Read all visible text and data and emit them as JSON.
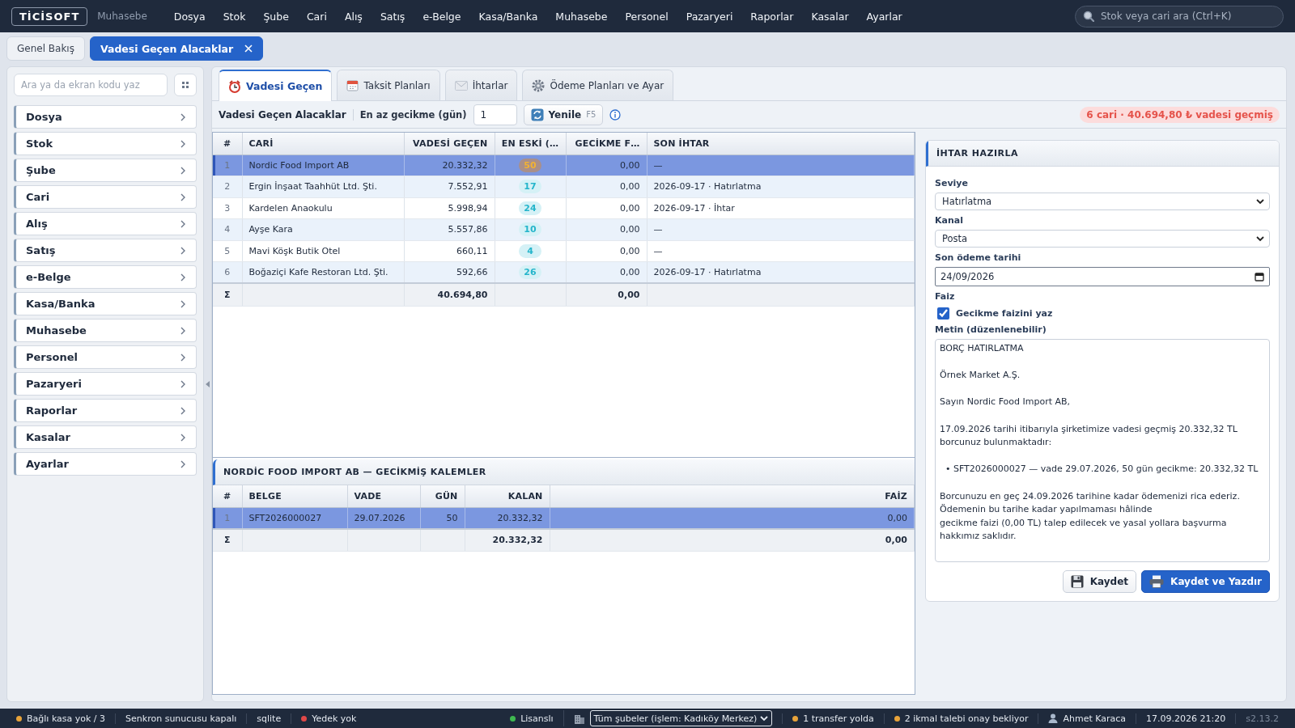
{
  "app": {
    "logo": "TİCİSOFT",
    "module": "Muhasebe"
  },
  "menu": [
    "Dosya",
    "Stok",
    "Şube",
    "Cari",
    "Alış",
    "Satış",
    "e-Belge",
    "Kasa/Banka",
    "Muhasebe",
    "Personel",
    "Pazaryeri",
    "Raporlar",
    "Kasalar",
    "Ayarlar"
  ],
  "search": {
    "placeholder": "Stok veya cari ara (Ctrl+K)"
  },
  "doc_tabs": [
    {
      "label": "Genel Bakış",
      "selected": false,
      "closable": false
    },
    {
      "label": "Vadesi Geçen Alacaklar",
      "selected": true,
      "closable": true
    }
  ],
  "sidebar": {
    "search": {
      "placeholder": "Ara ya da ekran kodu yaz"
    },
    "items": [
      "Dosya",
      "Stok",
      "Şube",
      "Cari",
      "Alış",
      "Satış",
      "e-Belge",
      "Kasa/Banka",
      "Muhasebe",
      "Personel",
      "Pazaryeri",
      "Raporlar",
      "Kasalar",
      "Ayarlar"
    ]
  },
  "tabs": [
    {
      "label": "Vadesi Geçen",
      "kind": "clock",
      "selected": true
    },
    {
      "label": "Taksit Planları",
      "kind": "calendar",
      "selected": false
    },
    {
      "label": "İhtarlar",
      "kind": "envelope",
      "selected": false
    },
    {
      "label": "Ödeme Planları ve Ayar",
      "kind": "gear",
      "selected": false
    }
  ],
  "toolbar": {
    "title": "Vadesi Geçen Alacaklar",
    "min_delay_label": "En az gecikme (gün)",
    "min_delay_value": "1",
    "refresh": {
      "label": "Yenile",
      "shortcut": "F5"
    },
    "summary": "6 cari · 40.694,80 ₺ vadesi geçmiş"
  },
  "overdue_table": {
    "columns": [
      {
        "label": "#",
        "kind": "index"
      },
      {
        "label": "CARİ",
        "kind": "text"
      },
      {
        "label": "VADESİ GEÇEN",
        "kind": "number",
        "total": "40.694,80"
      },
      {
        "label": "EN ESKİ (…",
        "kind": "badge"
      },
      {
        "label": "GECİKME F…",
        "kind": "number",
        "total": "0,00"
      },
      {
        "label": "SON İHTAR",
        "kind": "text"
      }
    ],
    "rows": [
      {
        "cells": [
          "1",
          "Nordic Food Import AB",
          "20.332,32",
          "50",
          "0,00",
          "—"
        ],
        "selected": true
      },
      {
        "cells": [
          "2",
          "Ergin İnşaat Taahhüt Ltd. Şti.",
          "7.552,91",
          "17",
          "0,00",
          "2026-09-17 · Hatırlatma"
        ],
        "selected": false
      },
      {
        "cells": [
          "3",
          "Kardelen Anaokulu",
          "5.998,94",
          "24",
          "0,00",
          "2026-09-17 · İhtar"
        ],
        "selected": false
      },
      {
        "cells": [
          "4",
          "Ayşe Kara",
          "5.557,86",
          "10",
          "0,00",
          "—"
        ],
        "selected": false
      },
      {
        "cells": [
          "5",
          "Mavi Köşk Butik Otel",
          "660,11",
          "4",
          "0,00",
          "—"
        ],
        "selected": false
      },
      {
        "cells": [
          "6",
          "Boğaziçi Kafe Restoran Ltd. Şti.",
          "592,66",
          "26",
          "0,00",
          "2026-09-17 · Hatırlatma"
        ],
        "selected": false
      }
    ],
    "totals_symbol": "Σ"
  },
  "details": {
    "title": "NORDİC FOOD IMPORT AB — GECİKMİŞ KALEMLER",
    "columns": [
      {
        "label": "#",
        "kind": "index"
      },
      {
        "label": "BELGE",
        "kind": "text"
      },
      {
        "label": "VADE",
        "kind": "text"
      },
      {
        "label": "GÜN",
        "kind": "number"
      },
      {
        "label": "KALAN",
        "kind": "number",
        "total": "20.332,32"
      },
      {
        "label": "FAİZ",
        "kind": "number",
        "total": "0,00"
      }
    ],
    "rows": [
      {
        "cells": [
          "1",
          "SFT2026000027",
          "29.07.2026",
          "50",
          "20.332,32",
          "0,00"
        ],
        "selected": true
      }
    ],
    "totals_symbol": "Σ"
  },
  "notice": {
    "title": "İHTAR HAZIRLA",
    "level": {
      "label": "Seviye",
      "value": "Hatırlatma"
    },
    "channel": {
      "label": "Kanal",
      "value": "Posta"
    },
    "due_date": {
      "label": "Son ödeme tarihi",
      "value": "24/09/2026"
    },
    "interest": {
      "label": "Faiz",
      "option": "Gecikme faizini yaz",
      "checked": true
    },
    "text": {
      "label": "Metin (düzenlenebilir)",
      "value": "BORÇ HATIRLATMA\n\nÖrnek Market A.Ş.\n\nSayın Nordic Food Import AB,\n\n17.09.2026 tarihi itibarıyla şirketimize vadesi geçmiş 20.332,32 TL borcunuz bulunmaktadır:\n\n  • SFT2026000027 — vade 29.07.2026, 50 gün gecikme: 20.332,32 TL\n\nBorcunuzu en geç 24.09.2026 tarihine kadar ödemenizi rica ederiz.\nÖdemenin bu tarihe kadar yapılmaması hâlinde\ngecikme faizi (0,00 TL) talep edilecek ve yasal yollara başvurma hakkımız saklıdır."
    },
    "buttons": [
      {
        "label": "Kaydet",
        "kind": "secondary"
      },
      {
        "label": "Kaydet ve Yazdır",
        "kind": "primary"
      }
    ]
  },
  "status_bar": {
    "left": [
      {
        "kind": "dot",
        "text": "Bağlı kasa yok / 3",
        "color": "#e8a33a"
      },
      {
        "kind": "text",
        "text": "Senkron sunucusu kapalı"
      },
      {
        "kind": "text",
        "text": "sqlite"
      },
      {
        "kind": "dot",
        "text": "Yedek yok",
        "color": "#e04848"
      }
    ],
    "right": [
      {
        "kind": "dot",
        "text": "Lisanslı",
        "color": "#3fb950"
      },
      {
        "kind": "branch_select",
        "text": "Tüm şubeler (işlem: Kadıköy Merkez)"
      },
      {
        "kind": "dot",
        "text": "1 transfer yolda",
        "color": "#e8a33a"
      },
      {
        "kind": "dot",
        "text": "2 ikmal talebi onay bekliyor",
        "color": "#e8a33a"
      },
      {
        "kind": "user",
        "text": "Ahmet Karaca"
      },
      {
        "kind": "text",
        "text": "17.09.2026 21:20"
      },
      {
        "kind": "version",
        "text": "s2.13.2"
      }
    ]
  }
}
